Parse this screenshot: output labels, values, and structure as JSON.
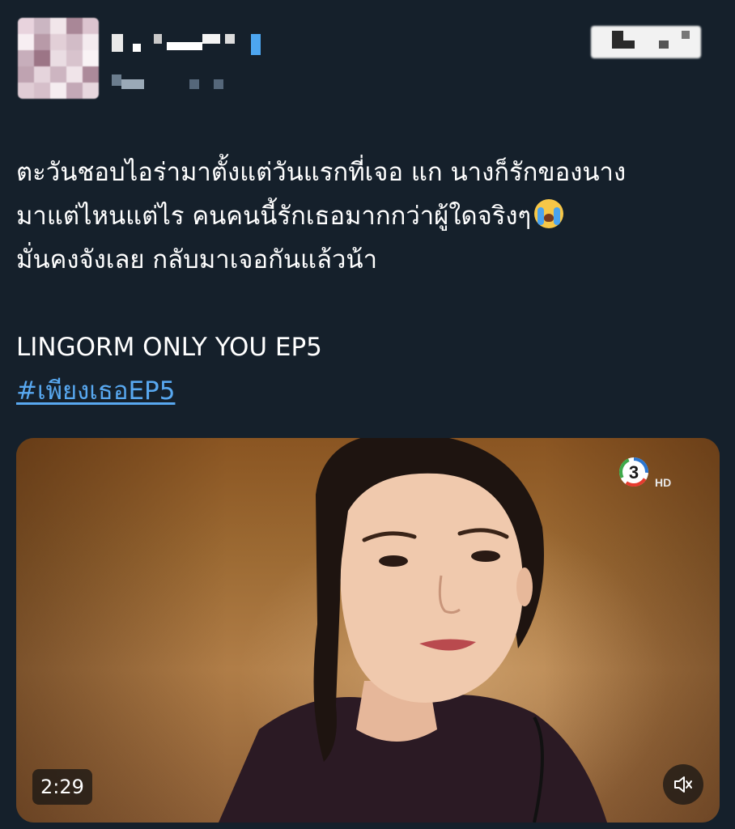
{
  "tweet": {
    "lines": [
      "ตะวันชอบไอร่ามาตั้งแต่วันแรกที่เจอ แก นางก็รักของนาง",
      "มาแต่ไหนแต่ไร คนคนนี้รักเธอมากกว่าผู้ใดจริงๆ",
      "มั่นคงจังเลย กลับมาเจอกันแล้วน้า"
    ],
    "emoji": "loudly-crying-face",
    "title_line": "LINGORM ONLY YOU EP5",
    "hashtag": "#เพียงเธอEP5"
  },
  "video": {
    "channel_logo": "channel-3-hd",
    "channel_logo_text": "HD",
    "channel_number": "3",
    "duration": "2:29",
    "mute_icon": "speaker-muted-icon"
  },
  "colors": {
    "background": "#15202b",
    "text": "#ffffff",
    "hashtag": "#58a8f0"
  }
}
